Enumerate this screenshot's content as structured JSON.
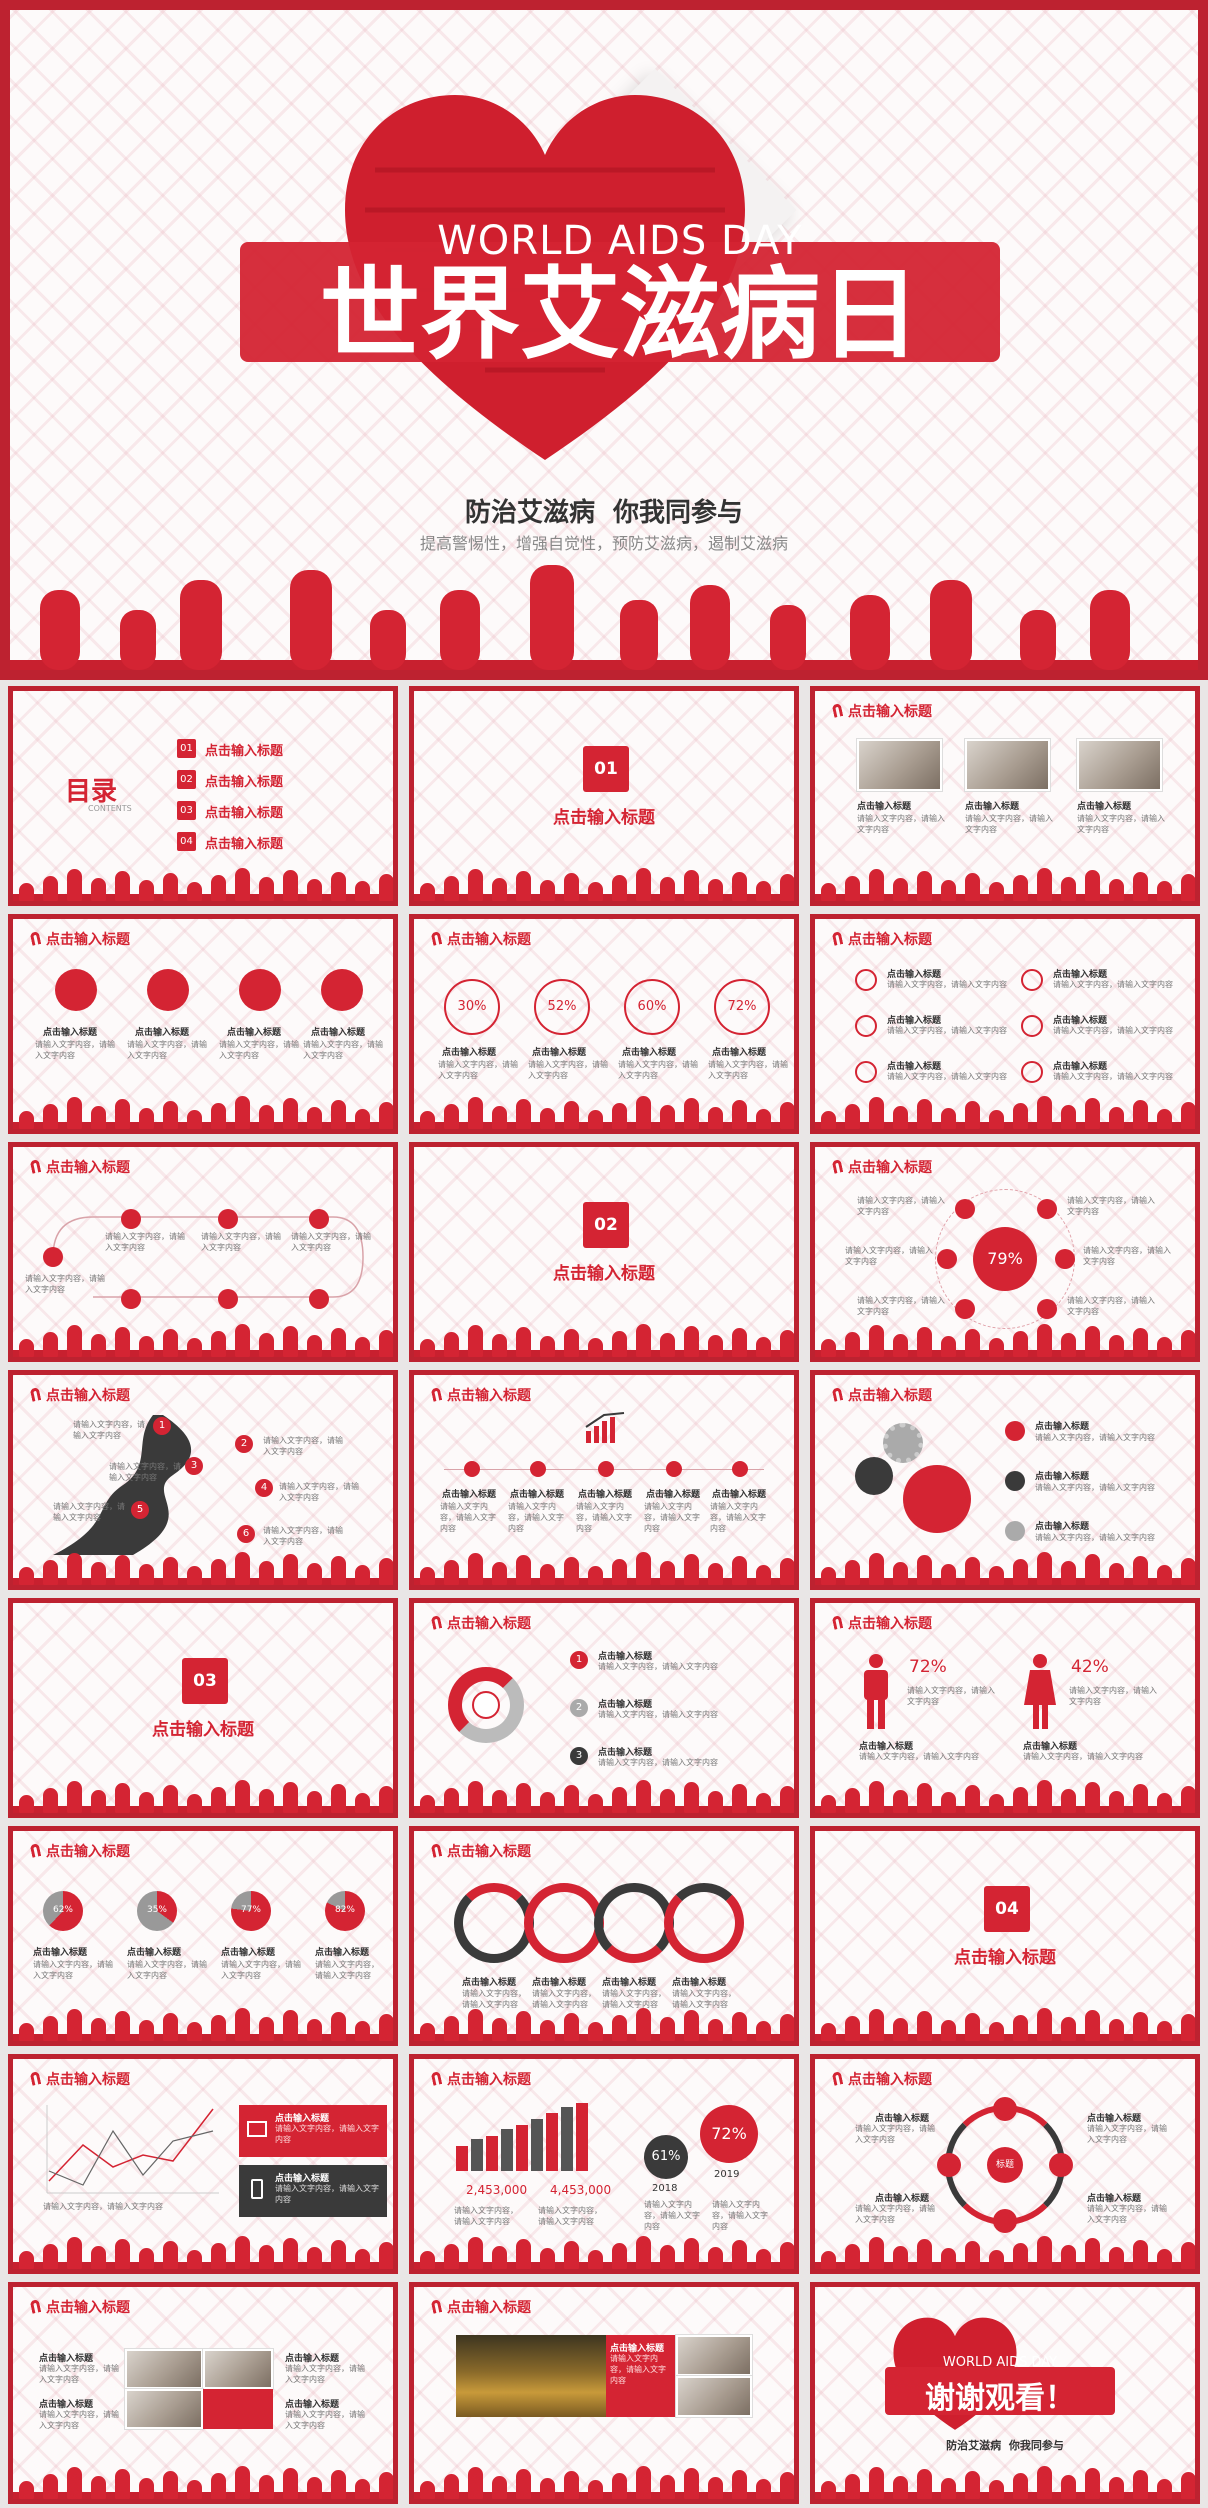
{
  "cover": {
    "title_en": "WORLD AIDS DAY",
    "title_cn": "世界艾滋病日",
    "slogan": "防治艾滋病  你我同参与",
    "subtitle": "提高警惕性，增强自觉性，预防艾滋病，遏制艾滋病"
  },
  "slide_title": "点击输入标题",
  "item_title": "点击输入标题",
  "body_text": "请输入文字内容，请输入文字内容",
  "toc": {
    "title": "目录",
    "subtitle": "CONTENTS",
    "items": [
      {
        "num": "01",
        "label": "点击输入标题"
      },
      {
        "num": "02",
        "label": "点击输入标题"
      },
      {
        "num": "03",
        "label": "点击输入标题"
      },
      {
        "num": "04",
        "label": "点击输入标题"
      }
    ]
  },
  "sections": [
    {
      "num": "01",
      "label": "点击输入标题"
    },
    {
      "num": "02",
      "label": "点击输入标题"
    },
    {
      "num": "03",
      "label": "点击输入标题"
    },
    {
      "num": "04",
      "label": "点击输入标题"
    }
  ],
  "rings": [
    "30%",
    "52%",
    "60%",
    "72%"
  ],
  "center_pct": "79%",
  "steps": [
    "1",
    "2",
    "3",
    "4",
    "5",
    "6"
  ],
  "gender": {
    "male": "72%",
    "female": "42%"
  },
  "pies": [
    "62%",
    "35%",
    "77%",
    "82%"
  ],
  "numbered": [
    "1",
    "2",
    "3"
  ],
  "stats": {
    "a": "2,453,000",
    "b": "4,453,000",
    "pct1": "61%",
    "pct2": "72%",
    "year1": "2018",
    "year2": "2019",
    "center": "标题"
  },
  "thanks": {
    "en": "WORLD AIDS DAY",
    "cn": "谢谢观看！",
    "slogan": "防治艾滋病  你我同参与"
  },
  "colors": {
    "brand": "#d42433",
    "dark": "#3a3a3a"
  }
}
